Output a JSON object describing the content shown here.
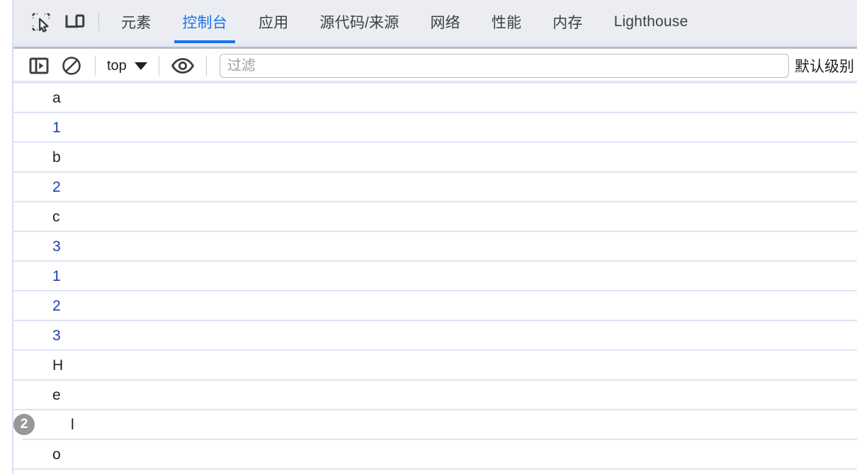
{
  "tabbar": {
    "icons": [
      {
        "name": "inspect-element-icon",
        "title": "检查元素"
      },
      {
        "name": "device-toolbar-icon",
        "title": "切换设备工具栏"
      }
    ],
    "tabs": [
      {
        "id": "elements",
        "label": "元素",
        "active": false
      },
      {
        "id": "console",
        "label": "控制台",
        "active": true
      },
      {
        "id": "application",
        "label": "应用",
        "active": false
      },
      {
        "id": "sources",
        "label": "源代码/来源",
        "active": false
      },
      {
        "id": "network",
        "label": "网络",
        "active": false
      },
      {
        "id": "performance",
        "label": "性能",
        "active": false
      },
      {
        "id": "memory",
        "label": "内存",
        "active": false
      },
      {
        "id": "lighthouse",
        "label": "Lighthouse",
        "active": false
      }
    ],
    "accent_color": "#1a73e8",
    "background_color": "#ebedf2"
  },
  "toolbar": {
    "sidebar_toggle": {
      "name": "console-sidebar-icon"
    },
    "clear_console": {
      "name": "clear-console-icon"
    },
    "context": {
      "label": "top"
    },
    "eye": {
      "name": "live-expression-eye-icon"
    },
    "filter": {
      "placeholder": "过滤",
      "value": ""
    },
    "level": {
      "label": "默认级别"
    }
  },
  "console": {
    "messages": [
      {
        "text": "a",
        "kind": "string",
        "repeat": 0
      },
      {
        "text": "1",
        "kind": "number",
        "repeat": 0
      },
      {
        "text": "b",
        "kind": "string",
        "repeat": 0
      },
      {
        "text": "2",
        "kind": "number",
        "repeat": 0
      },
      {
        "text": "c",
        "kind": "string",
        "repeat": 0
      },
      {
        "text": "3",
        "kind": "number",
        "repeat": 0
      },
      {
        "text": "1",
        "kind": "number",
        "repeat": 0
      },
      {
        "text": "2",
        "kind": "number",
        "repeat": 0
      },
      {
        "text": "3",
        "kind": "number",
        "repeat": 0
      },
      {
        "text": "H",
        "kind": "string",
        "repeat": 0
      },
      {
        "text": "e",
        "kind": "string",
        "repeat": 0
      },
      {
        "text": "l",
        "kind": "string",
        "repeat": 2
      },
      {
        "text": "o",
        "kind": "string",
        "repeat": 0
      }
    ],
    "string_color": "#202124",
    "number_color": "#1a3fb0",
    "badge_color": "#979797",
    "separator_color": "#dce4f5"
  }
}
